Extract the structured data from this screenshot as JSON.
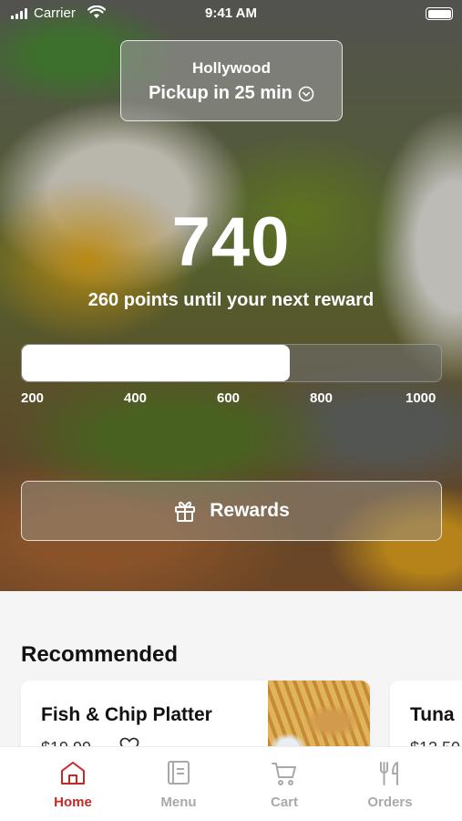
{
  "status_bar": {
    "carrier": "Carrier",
    "time": "9:41 AM"
  },
  "location": {
    "name": "Hollywood",
    "pickup": "Pickup in 25 min"
  },
  "rewards": {
    "points": "740",
    "until_text": "260 points until your next reward",
    "progress_fraction": 0.64,
    "ticks": [
      "200",
      "400",
      "600",
      "800",
      "1000"
    ],
    "button_label": "Rewards"
  },
  "recommended": {
    "title": "Recommended",
    "items": [
      {
        "name": "Fish & Chip Platter",
        "price": "$19.99"
      },
      {
        "name": "Tuna",
        "price": "$12.50"
      }
    ]
  },
  "tabbar": {
    "items": [
      {
        "label": "Home",
        "icon": "home-icon",
        "active": true
      },
      {
        "label": "Menu",
        "icon": "menu-book-icon",
        "active": false
      },
      {
        "label": "Cart",
        "icon": "cart-icon",
        "active": false
      },
      {
        "label": "Orders",
        "icon": "fork-knife-icon",
        "active": false
      }
    ]
  },
  "colors": {
    "accent": "#c62828",
    "inactive_tab": "#a9a9a9"
  }
}
